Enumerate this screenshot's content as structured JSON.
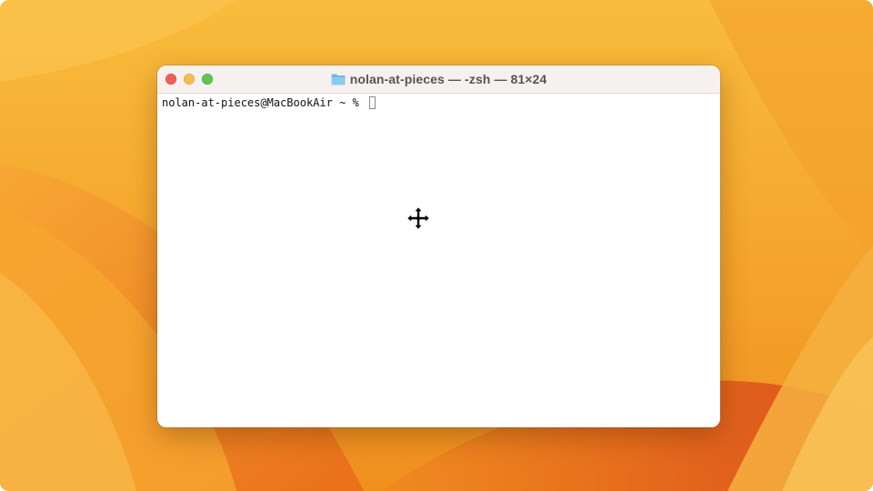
{
  "window": {
    "title": "nolan-at-pieces — -zsh — 81×24",
    "title_icon": "folder-icon"
  },
  "terminal": {
    "prompt": "nolan-at-pieces@MacBookAir ~ % ",
    "cursor_icon": "text-cursor-block"
  },
  "pointer": {
    "icon": "move-cursor-icon"
  },
  "colors": {
    "close": "#ee5f57",
    "minimize": "#f4bd4f",
    "zoom": "#5fc454",
    "wallpaper_light": "#f8c04a",
    "wallpaper_dark": "#e0561c"
  }
}
